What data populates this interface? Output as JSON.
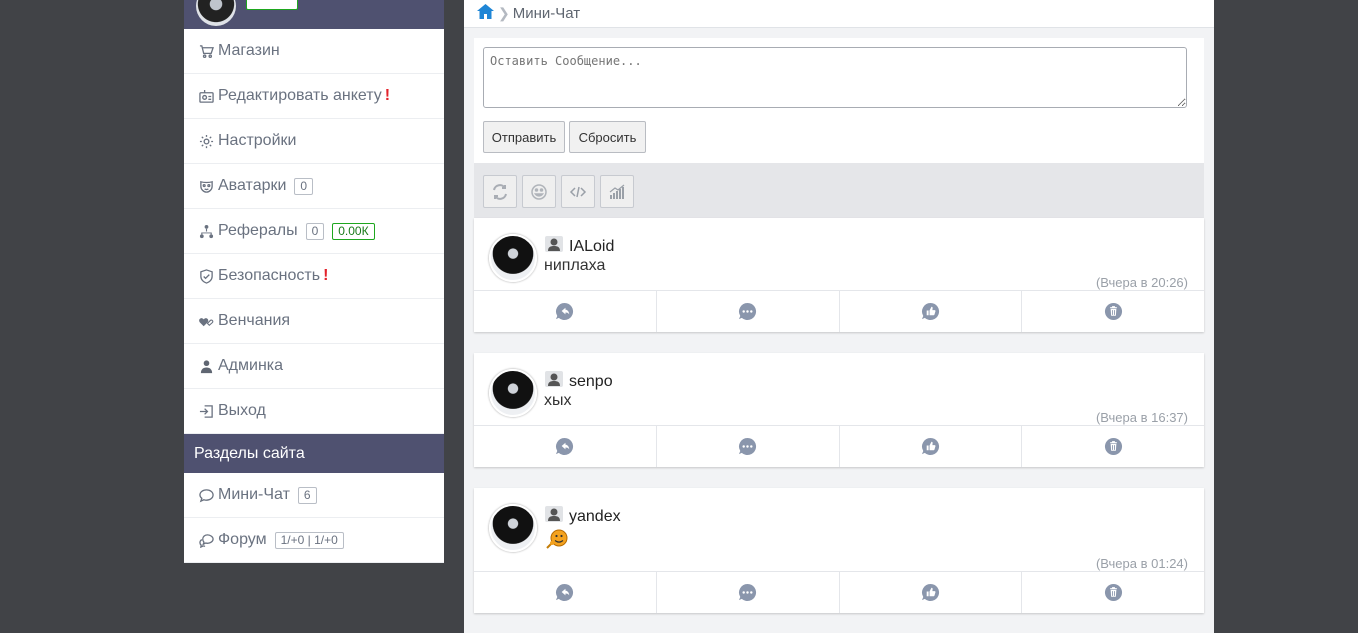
{
  "sidebar": {
    "profile_badge": "",
    "items": [
      {
        "label": "Магазин",
        "icon": "cart-icon"
      },
      {
        "label": "Редактировать анкету",
        "icon": "id-card-icon",
        "alert": "!"
      },
      {
        "label": "Настройки",
        "icon": "gear-icon"
      },
      {
        "label": "Аватарки",
        "icon": "mask-icon",
        "count": "0"
      },
      {
        "label": "Рефералы",
        "icon": "hierarchy-icon",
        "count": "0",
        "balance": "0.00К"
      },
      {
        "label": "Безопасность",
        "icon": "shield-icon",
        "alert": "!"
      },
      {
        "label": "Венчания",
        "icon": "hearts-icon"
      },
      {
        "label": "Админка",
        "icon": "user-icon"
      },
      {
        "label": "Выход",
        "icon": "logout-icon"
      }
    ],
    "section_title": "Разделы сайта",
    "sections": [
      {
        "label": "Мини-Чат",
        "icon": "chat-bubble-icon",
        "count": "6"
      },
      {
        "label": "Форум",
        "icon": "chat-bubbles-icon",
        "count": "1/+0 | 1/+0"
      }
    ]
  },
  "breadcrumb": {
    "current": "Мини-Чат"
  },
  "compose": {
    "placeholder": "Оставить Сообщение...",
    "send_label": "Отправить",
    "reset_label": "Сбросить"
  },
  "messages": [
    {
      "user": "IALoid",
      "text": "ниплаха",
      "time": "(Вчера в 20:26)"
    },
    {
      "user": "senpo",
      "text": "хых",
      "time": "(Вчера в 16:37)"
    },
    {
      "user": "yandex",
      "text": "",
      "time": "(Вчера в 01:24)"
    }
  ],
  "colors": {
    "accent": "#4f5170",
    "background": "#414347",
    "alert": "#e3222b",
    "success": "#1ea71e"
  }
}
